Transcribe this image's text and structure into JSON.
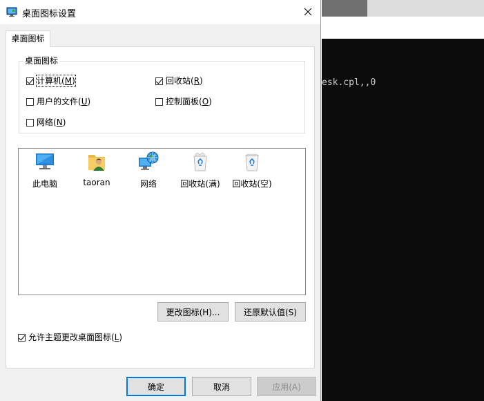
{
  "background": {
    "terminal_line": "esk.cpl,,0"
  },
  "dialog": {
    "title": "桌面图标设置",
    "close_glyph": "✕",
    "tab_label": "桌面图标",
    "group_title": "桌面图标",
    "checkboxes": [
      {
        "text": "计算机",
        "mnemonic": "M",
        "checked": true
      },
      {
        "text": "回收站",
        "mnemonic": "R",
        "checked": true
      },
      {
        "text": "用户的文件",
        "mnemonic": "U",
        "checked": false
      },
      {
        "text": "控制面板",
        "mnemonic": "O",
        "checked": false
      },
      {
        "text": "网络",
        "mnemonic": "N",
        "checked": false
      }
    ],
    "icons": [
      {
        "label": "此电脑",
        "icon": "monitor-icon"
      },
      {
        "label": "taoran",
        "icon": "user-folder-icon"
      },
      {
        "label": "网络",
        "icon": "network-globe-icon"
      },
      {
        "label": "回收站(满)",
        "icon": "recycle-bin-full-icon"
      },
      {
        "label": "回收站(空)",
        "icon": "recycle-bin-empty-icon"
      }
    ],
    "change_icon_btn": "更改图标(H)...",
    "restore_default_btn": "还原默认值(S)",
    "allow_themes": {
      "text": "允许主题更改桌面图标",
      "mnemonic": "L",
      "checked": true
    },
    "ok_btn": "确定",
    "cancel_btn": "取消",
    "apply_btn": "应用(A)"
  }
}
